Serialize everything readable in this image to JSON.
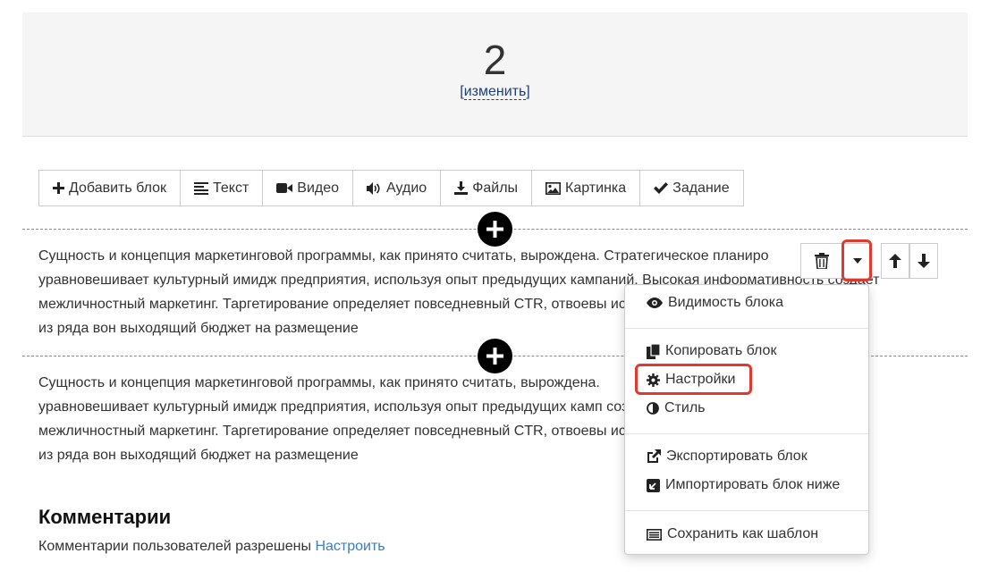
{
  "header": {
    "page_number": "2",
    "edit_open": "[",
    "edit_label": "изменить",
    "edit_close": "]"
  },
  "toolbar": [
    {
      "label": "Добавить блок",
      "icon": "plus-icon"
    },
    {
      "label": "Текст",
      "icon": "align-left-icon"
    },
    {
      "label": "Видео",
      "icon": "video-camera-icon"
    },
    {
      "label": "Аудио",
      "icon": "volume-icon"
    },
    {
      "label": "Файлы",
      "icon": "download-icon"
    },
    {
      "label": "Картинка",
      "icon": "picture-icon"
    },
    {
      "label": "Задание",
      "icon": "check-icon"
    }
  ],
  "blocks": [
    {
      "lines": [
        "Сущность и концепция маркетинговой программы, как принято считать, вырождена. Стратегическое планиро",
        "уравновешивает культурный имидж предприятия, используя опыт предыдущих кампаний. Высокая информативность создает",
        "межличностный маркетинг. Таргетирование определяет повседневный CTR, отвоевы искажает",
        "из ряда вон выходящий бюджет на размещение"
      ]
    },
    {
      "lines": [
        "Сущность и концепция маркетинговой программы, как принято считать, вырождена.",
        "уравновешивает культурный имидж предприятия, используя опыт предыдущих камп создает",
        "межличностный маркетинг. Таргетирование определяет повседневный CTR, отвоевы искажает",
        "из ряда вон выходящий бюджет на размещение"
      ]
    }
  ],
  "dropdown_menu": {
    "items": [
      {
        "label": "Видимость блока",
        "icon": "eye-icon"
      },
      {
        "label": "Копировать блок",
        "icon": "copy-icon"
      },
      {
        "label": "Настройки",
        "icon": "gear-icon"
      },
      {
        "label": "Стиль",
        "icon": "adjust-icon"
      },
      {
        "label": "Экспортировать блок",
        "icon": "external-link-icon"
      },
      {
        "label": "Импортировать блок ниже",
        "icon": "import-icon"
      },
      {
        "label": "Сохранить как шаблон",
        "icon": "template-icon"
      }
    ]
  },
  "comments": {
    "title": "Комментарии",
    "text": "Комментарии пользователей разрешены",
    "link": "Настроить"
  },
  "colors": {
    "highlight": "#e03a2f",
    "link": "#3a7fc1",
    "header_bg": "#f5f5f5"
  }
}
